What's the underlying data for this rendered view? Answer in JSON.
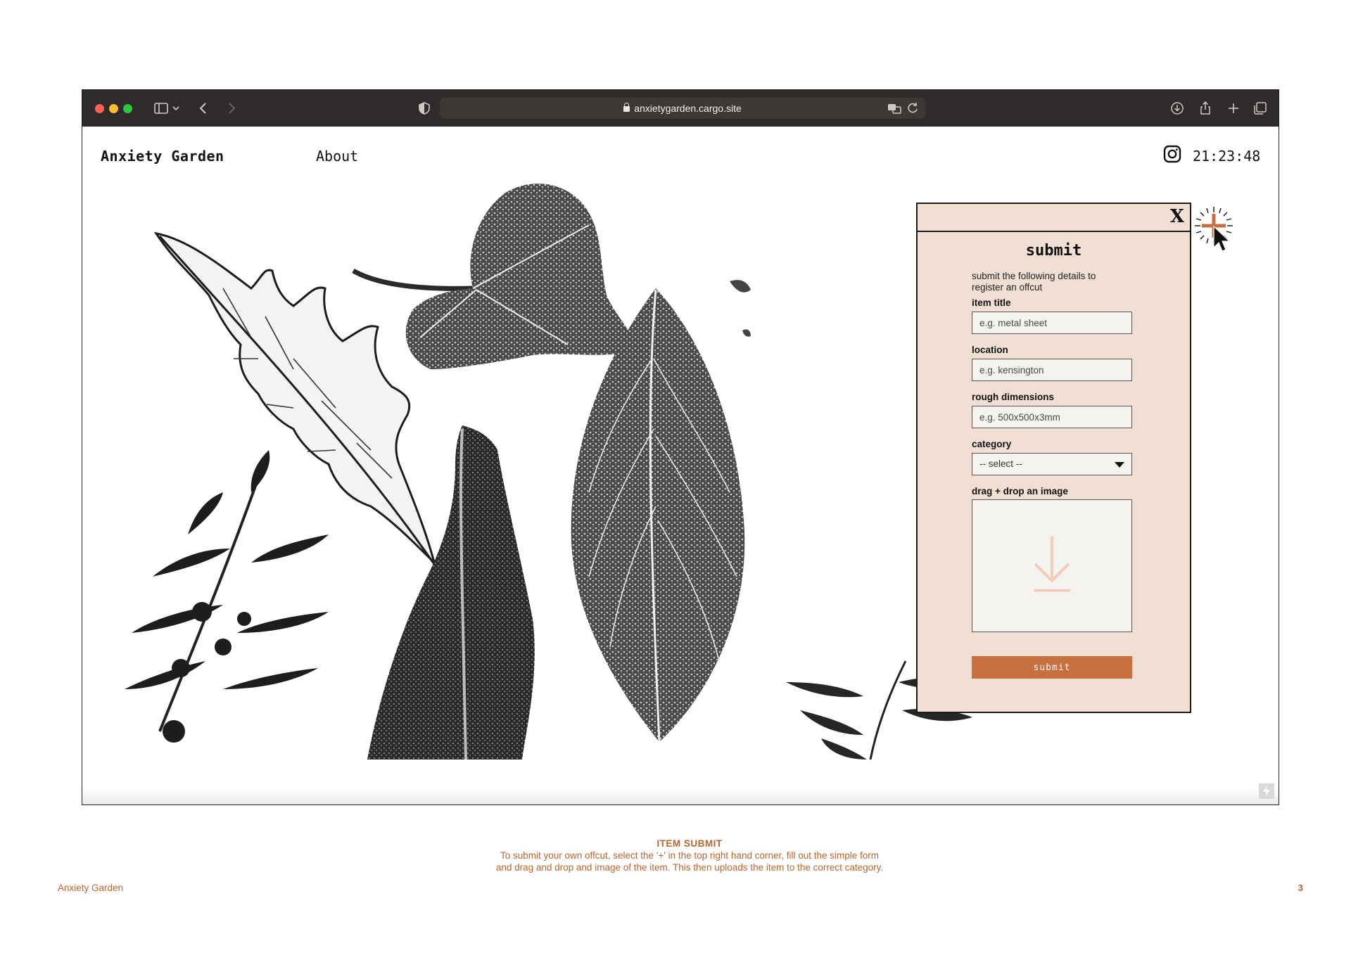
{
  "browser": {
    "url": "anxietygarden.cargo.site"
  },
  "site": {
    "title": "Anxiety Garden",
    "nav_about": "About",
    "clock": "21:23:48"
  },
  "modal": {
    "close_label": "X",
    "title": "submit",
    "description": "submit the following details to register an offcut",
    "fields": {
      "item_title": {
        "label": "item title",
        "placeholder": "e.g. metal sheet"
      },
      "location": {
        "label": "location",
        "placeholder": "e.g. kensington"
      },
      "dimensions": {
        "label": "rough dimensions",
        "placeholder": "e.g. 500x500x3mm"
      },
      "category": {
        "label": "category",
        "selected": "-- select --"
      },
      "image": {
        "label": "drag + drop an image"
      }
    },
    "submit_label": "submit"
  },
  "caption": {
    "title": "ITEM SUBMIT",
    "body": "To submit your own offcut, select the '+' in the top right hand corner, fill out the simple form and drag and drop and image of the item. This then uploads the item to the correct category."
  },
  "footer": {
    "left": "Anxiety Garden",
    "page_number": "3"
  },
  "colors": {
    "accent": "#c86f3f",
    "modal_bg": "#f2dfd4",
    "toolbar_bg": "#2f2b2a"
  }
}
